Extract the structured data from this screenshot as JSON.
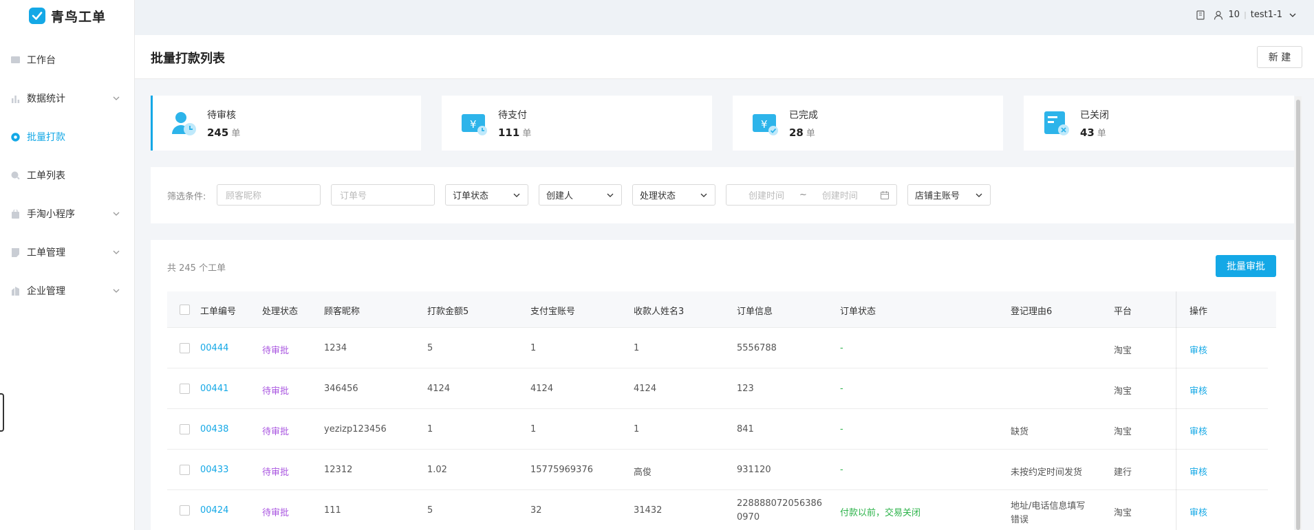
{
  "app": {
    "name": "青鸟工单"
  },
  "topbar": {
    "count": "10",
    "user": "test1-1"
  },
  "sidebar": {
    "items": [
      {
        "label": "工作台",
        "icon": "desktop-icon",
        "expandable": false,
        "active": false
      },
      {
        "label": "数据统计",
        "icon": "bar-chart-icon",
        "expandable": true,
        "active": false
      },
      {
        "label": "批量打款",
        "icon": "payment-icon",
        "expandable": false,
        "active": true
      },
      {
        "label": "工单列表",
        "icon": "search-icon",
        "expandable": false,
        "active": false
      },
      {
        "label": "手淘小程序",
        "icon": "shopping-bag-icon",
        "expandable": true,
        "active": false
      },
      {
        "label": "工单管理",
        "icon": "document-icon",
        "expandable": true,
        "active": false
      },
      {
        "label": "企业管理",
        "icon": "building-icon",
        "expandable": true,
        "active": false
      }
    ]
  },
  "page": {
    "title": "批量打款列表",
    "new_button": "新 建"
  },
  "stats": [
    {
      "name": "待审核",
      "count": "245",
      "unit": "单",
      "icon": "user-clock-icon"
    },
    {
      "name": "待支付",
      "count": "111",
      "unit": "单",
      "icon": "yuan-wallet-icon"
    },
    {
      "name": "已完成",
      "count": "28",
      "unit": "单",
      "icon": "yuan-check-icon"
    },
    {
      "name": "已关闭",
      "count": "43",
      "unit": "单",
      "icon": "form-close-icon"
    }
  ],
  "filters": {
    "label": "筛选条件:",
    "customer_placeholder": "顾客昵称",
    "order_placeholder": "订单号",
    "order_status": "订单状态",
    "creator": "创建人",
    "process_status": "处理状态",
    "date_start": "创建时间",
    "date_sep": "~",
    "date_end": "创建时间",
    "shop_account": "店铺主账号"
  },
  "table": {
    "total_text": "共 245 个工单",
    "batch_button": "批量审批",
    "headers": [
      "工单编号",
      "处理状态",
      "顾客昵称",
      "打款金额5",
      "支付宝账号",
      "收款人姓名3",
      "订单信息",
      "订单状态",
      "登记理由6",
      "平台",
      "操作"
    ],
    "rows": [
      {
        "id": "00444",
        "status": "待审批",
        "customer": "1234",
        "amount": "5",
        "alipay": "1",
        "payee": "1",
        "order_info_1": "5556788",
        "order_info_2": "",
        "order_status": "-",
        "reason_1": "",
        "reason_2": "",
        "platform": "淘宝",
        "action": "审核"
      },
      {
        "id": "00441",
        "status": "待审批",
        "customer": "346456",
        "amount": "4124",
        "alipay": "4124",
        "payee": "4124",
        "order_info_1": "123",
        "order_info_2": "",
        "order_status": "-",
        "reason_1": "",
        "reason_2": "",
        "platform": "淘宝",
        "action": "审核"
      },
      {
        "id": "00438",
        "status": "待审批",
        "customer": "yezizp123456",
        "amount": "1",
        "alipay": "1",
        "payee": "1",
        "order_info_1": "841",
        "order_info_2": "",
        "order_status": "-",
        "reason_1": "缺货",
        "reason_2": "",
        "platform": "淘宝",
        "action": "审核"
      },
      {
        "id": "00433",
        "status": "待审批",
        "customer": "12312",
        "amount": "1.02",
        "alipay": "15775969376",
        "payee": "高俊",
        "order_info_1": "931120",
        "order_info_2": "",
        "order_status": "-",
        "reason_1": "未按约定时间发货",
        "reason_2": "",
        "platform": "建行",
        "action": "审核"
      },
      {
        "id": "00424",
        "status": "待审批",
        "customer": "111",
        "amount": "5",
        "alipay": "32",
        "payee": "31432",
        "order_info_1": "228888072056386",
        "order_info_2": "0970",
        "order_status": "付款以前，交易关闭",
        "reason_1": "地址/电话信息填写",
        "reason_2": "错误",
        "platform": "淘宝",
        "action": "审核"
      }
    ]
  },
  "colors": {
    "accent": "#14a8e6",
    "pending": "#a955e0",
    "closed_status": "#2cb34a"
  }
}
